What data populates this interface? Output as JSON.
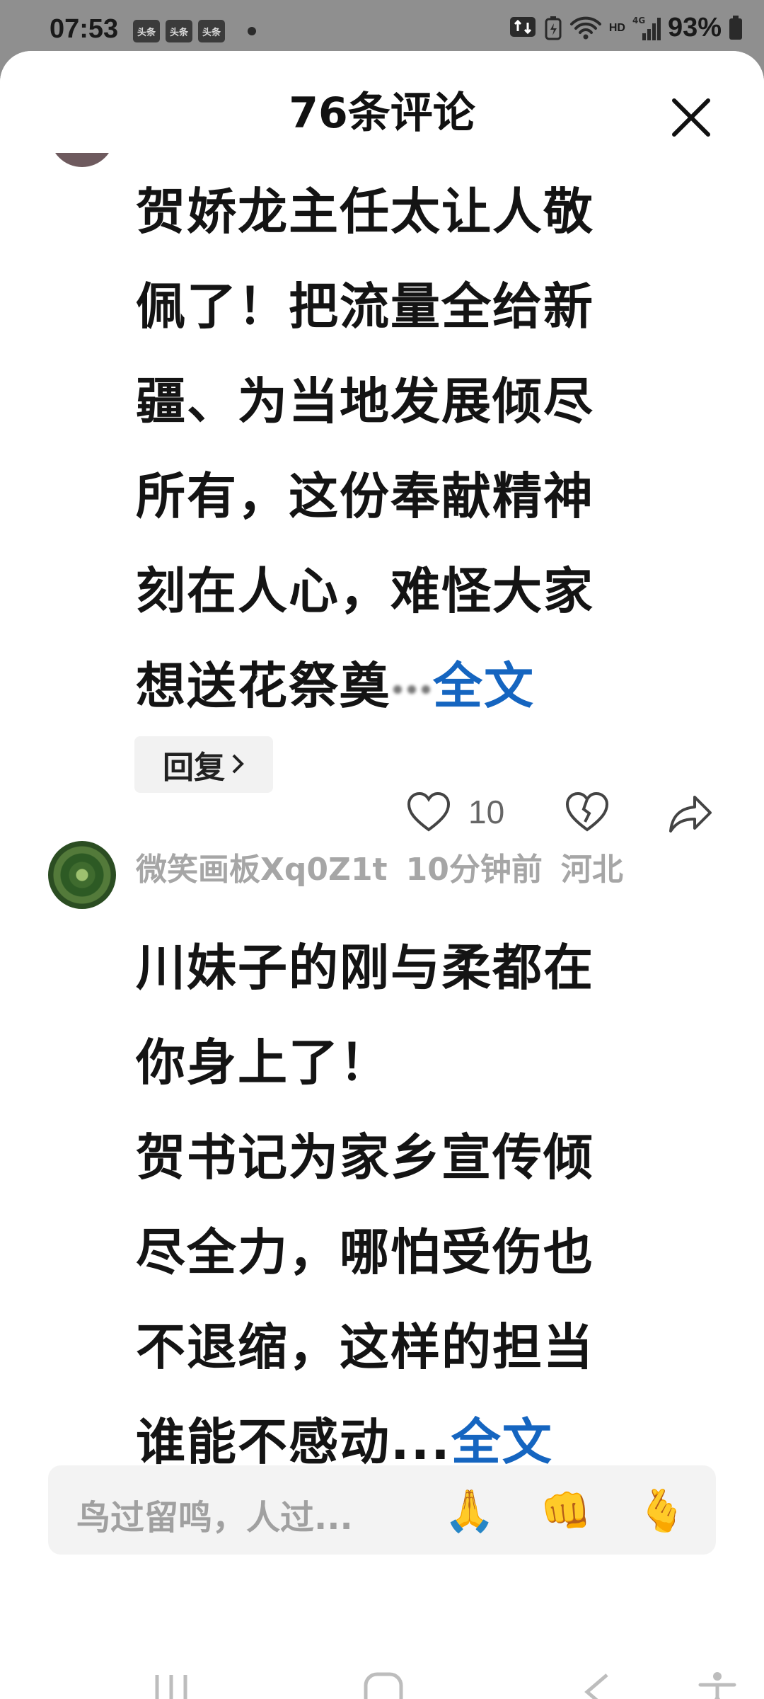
{
  "status_bar": {
    "time": "07:53",
    "app_badges": [
      "头条",
      "头条",
      "头条"
    ],
    "network": "HD",
    "signal": "4G",
    "battery": "93%"
  },
  "sheet": {
    "title": "76条评论",
    "close_icon": "close-icon"
  },
  "comments": [
    {
      "lines": [
        "贺娇龙主任太让人敬",
        "佩了！把流量全给新",
        "疆、为当地发展倾尽",
        "所有，这份奉献精神",
        "刻在人心，难怪大家",
        "想送花祭奠"
      ],
      "truncation": "...",
      "full_text_link": "全文",
      "reply_label": "回复",
      "like_count": "10"
    },
    {
      "username": "微笑画板Xq0Z1t",
      "time": "10分钟前",
      "location": "河北",
      "lines": [
        "川妹子的刚与柔都在",
        "你身上了！",
        "贺书记为家乡宣传倾",
        "尽全力，哪怕受伤也",
        "不退缩，这样的担当",
        "谁能不感动..."
      ],
      "full_text_link": "全文"
    }
  ],
  "input_bar": {
    "placeholder": "鸟过留鸣，人过...",
    "emojis": [
      "🙏",
      "👊",
      "🫰"
    ]
  },
  "colors": {
    "link": "#1565c0",
    "meta": "#a6a6a6",
    "text": "#141414"
  }
}
